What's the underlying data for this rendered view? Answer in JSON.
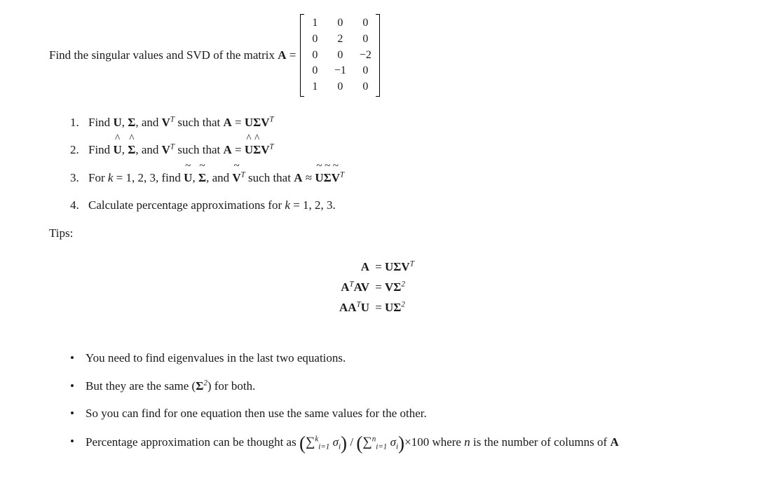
{
  "intro_prefix": "Find the singular values and SVD of the matrix ",
  "matrix_A_label": "A",
  "eq_sign": " = ",
  "matrix": {
    "r1c1": "1",
    "r1c2": "0",
    "r1c3": "0",
    "r2c1": "0",
    "r2c2": "2",
    "r2c3": "0",
    "r3c1": "0",
    "r3c2": "0",
    "r3c3": "−2",
    "r4c1": "0",
    "r4c2": "−1",
    "r4c3": "0",
    "r5c1": "1",
    "r5c2": "0",
    "r5c3": "0"
  },
  "steps": {
    "n1": "1.",
    "s1_a": "Find ",
    "s1_U": "U",
    "s1_c": ", ",
    "s1_S": "Σ",
    "s1_d": ", and ",
    "s1_V": "V",
    "s1_T": "T",
    "s1_e": " such that ",
    "s1_A": "A",
    "s1_eq": " = ",
    "n2": "2.",
    "s2_a": "Find ",
    "s2_U": "U",
    "s2_c": ", ",
    "s2_S": "Σ",
    "s2_d": ", and ",
    "s2_V": "V",
    "s2_T": "T",
    "s2_e": " such that ",
    "s2_A": "A",
    "s2_eq": " = ",
    "hat": "^",
    "n3": "3.",
    "s3_a": "For ",
    "s3_k": "k",
    "s3_b": " = 1, 2, 3, find ",
    "s3_U": "U",
    "s3_c": ", ",
    "s3_S": "Σ",
    "s3_d": ", and ",
    "s3_V": "V",
    "s3_T": "T",
    "s3_e": " such that ",
    "s3_A": "A",
    "s3_approx": " ≈ ",
    "tilde": "~",
    "n4": "4.",
    "s4": "Calculate percentage approximations for ",
    "s4_k": "k",
    "s4_b": " = 1, 2, 3."
  },
  "tips_label": "Tips:",
  "eqs": {
    "l1_lhs": "A",
    "l1_rhs_U": "U",
    "l1_rhs_S": "Σ",
    "l1_rhs_V": "V",
    "l1_T": "T",
    "l2_lhs_A1": "A",
    "l2_lhs_T": "T",
    "l2_lhs_A2": "A",
    "l2_lhs_V": "V",
    "l2_rhs_V": "V",
    "l2_rhs_S": "Σ",
    "l2_sq": "2",
    "l3_lhs_A1": "A",
    "l3_lhs_A2": "A",
    "l3_lhs_T": "T",
    "l3_lhs_U": "U",
    "l3_rhs_U": "U",
    "l3_rhs_S": "Σ",
    "l3_sq": "2",
    "eq": "="
  },
  "bullets": {
    "dot": "•",
    "b1": "You need to find eigenvalues in the last two equations.",
    "b2_a": "But they are the same (",
    "b2_S": "Σ",
    "b2_sq": "2",
    "b2_b": ") for both.",
    "b3": "So you can find for one equation then use the same values for the other.",
    "b4_a": "Percentage approximation can be thought as ",
    "b4_sum": "∑",
    "b4_i1": "i=1",
    "b4_k": "k",
    "b4_n": "n",
    "b4_sig": "σ",
    "b4_i": "i",
    "b4_div": " / ",
    "b4_times": "×100 where ",
    "b4_nvar": "n",
    "b4_end": " is the number of columns of ",
    "b4_A": "A",
    "lp": "(",
    "rp": ")"
  }
}
